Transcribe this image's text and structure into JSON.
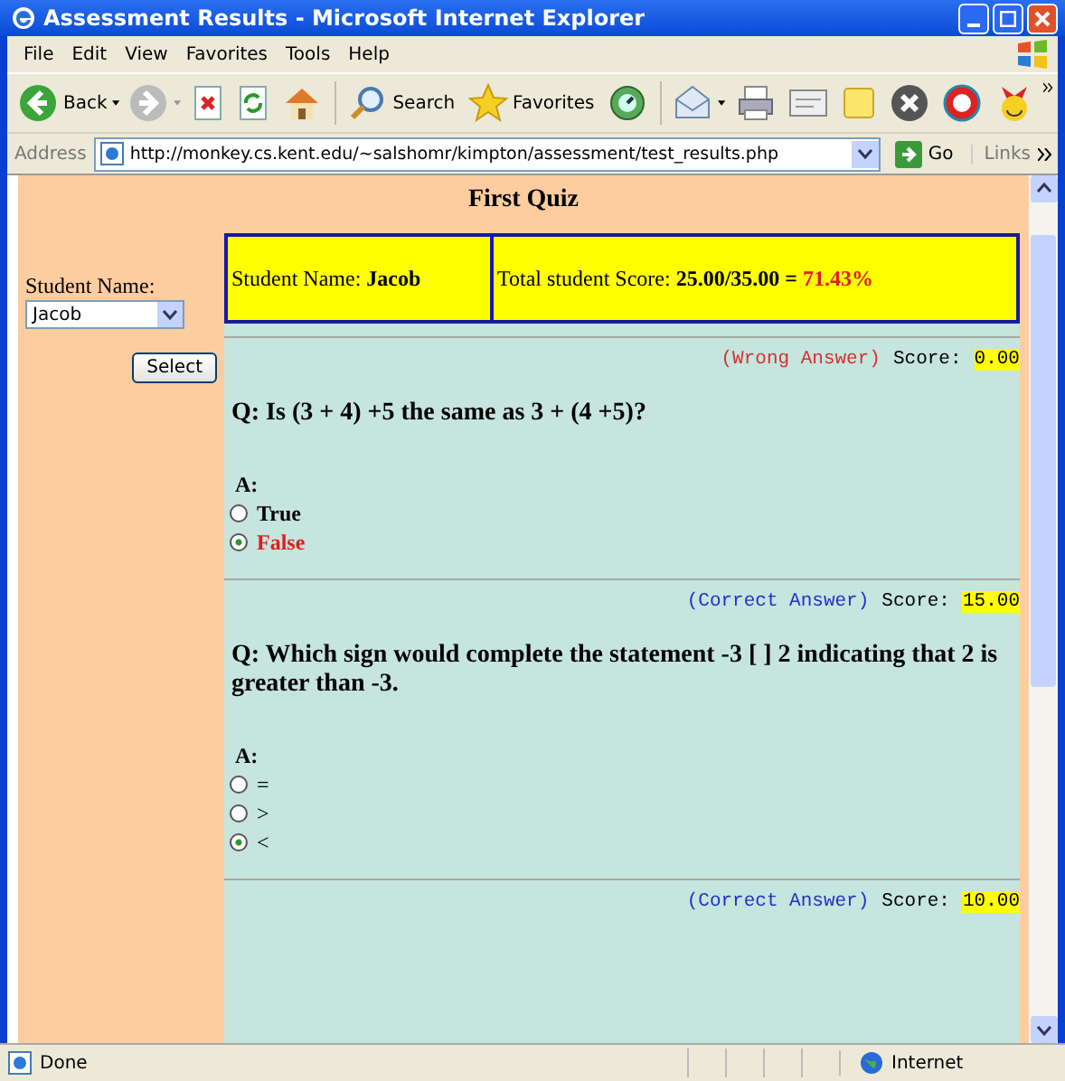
{
  "window": {
    "title": "Assessment Results - Microsoft Internet Explorer"
  },
  "menu": [
    "File",
    "Edit",
    "View",
    "Favorites",
    "Tools",
    "Help"
  ],
  "toolbar": [
    {
      "kind": "back",
      "label": "Back"
    },
    {
      "kind": "forward"
    },
    {
      "kind": "stop"
    },
    {
      "kind": "refresh"
    },
    {
      "kind": "home"
    },
    {
      "kind": "search",
      "label": "Search"
    },
    {
      "kind": "favorites",
      "label": "Favorites"
    },
    {
      "kind": "media"
    },
    {
      "kind": "mail"
    },
    {
      "kind": "print"
    },
    {
      "kind": "edit"
    },
    {
      "kind": "note"
    },
    {
      "kind": "messenger"
    },
    {
      "kind": "yahoo"
    },
    {
      "kind": "smiley"
    }
  ],
  "address": {
    "label": "Address",
    "url": "http://monkey.cs.kent.edu/~salshomr/kimpton/assessment/test_results.php",
    "go": "Go",
    "links": "Links"
  },
  "page": {
    "heading": "First Quiz",
    "sidebar": {
      "label": "Student Name:",
      "select_value": "Jacob",
      "button": "Select"
    },
    "summary": {
      "name": "Student Name: **Jacob**",
      "score": "Total student Score: **25.00/35.00 =**",
      "percent": "71.43%"
    },
    "questions": [
      {
        "kind": "wrong",
        "result": "(Wrong Answer)",
        "score_label": "Score:",
        "score": "0.00",
        "question": "Q: Is (3 + 4) +5 the same as 3 + (4 +5)?",
        "answer_label": "A:",
        "bold_options": true,
        "options": [
          {
            "label": "True",
            "selected": false
          },
          {
            "label": "False",
            "selected": true
          }
        ]
      },
      {
        "kind": "correct",
        "result": "(Correct Answer)",
        "score_label": "Score:",
        "score": "15.00",
        "question": "Q: Which sign would complete the statement -3 [ ] 2 indicating that 2 is greater than -3.",
        "answer_label": "A:",
        "bold_options": false,
        "options": [
          {
            "label": "=",
            "selected": false
          },
          {
            "label": ">",
            "selected": false
          },
          {
            "label": "<",
            "selected": true
          }
        ]
      },
      {
        "kind": "correct",
        "result": "(Correct Answer)",
        "score_label": "Score:",
        "score": "10.00"
      }
    ]
  },
  "status": {
    "text": "Done",
    "zone": "Internet"
  }
}
